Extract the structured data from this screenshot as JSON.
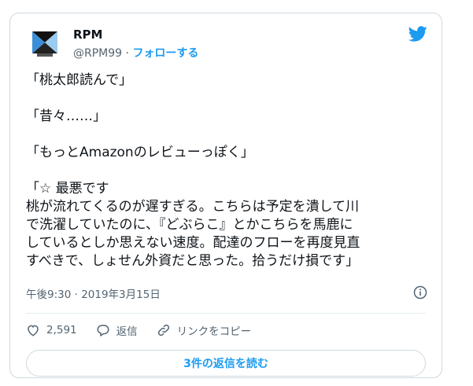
{
  "tweet": {
    "author_name": "RPM",
    "handle": "@RPM99",
    "separator": " · ",
    "follow_label": "フォローする",
    "lines": [
      "「桃太郎読んで」",
      "",
      "「昔々……」",
      "",
      "「もっとAmazonのレビューっぽく」",
      "",
      "「☆ 最悪です",
      "桃が流れてくるのが遅すぎる。こちらは予定を潰して川",
      "で洗濯していたのに、『どぶらこ』とかこちらを馬鹿に",
      "しているとしか思えない速度。配達のフローを再度見直",
      "すべきで、しょせん外資だと思った。拾うだけ損です」"
    ],
    "timestamp": "午後9:30 · 2019年3月15日",
    "like_count": "2,591",
    "reply_label": "返信",
    "copy_link_label": "リンクをコピー",
    "read_replies_label": "3件の返信を読む"
  },
  "colors": {
    "accent": "#1d9bf0",
    "muted": "#536471",
    "border": "#cfd9de"
  },
  "icons": [
    "twitter-bird-icon",
    "info-icon",
    "heart-icon",
    "reply-icon",
    "link-icon"
  ]
}
